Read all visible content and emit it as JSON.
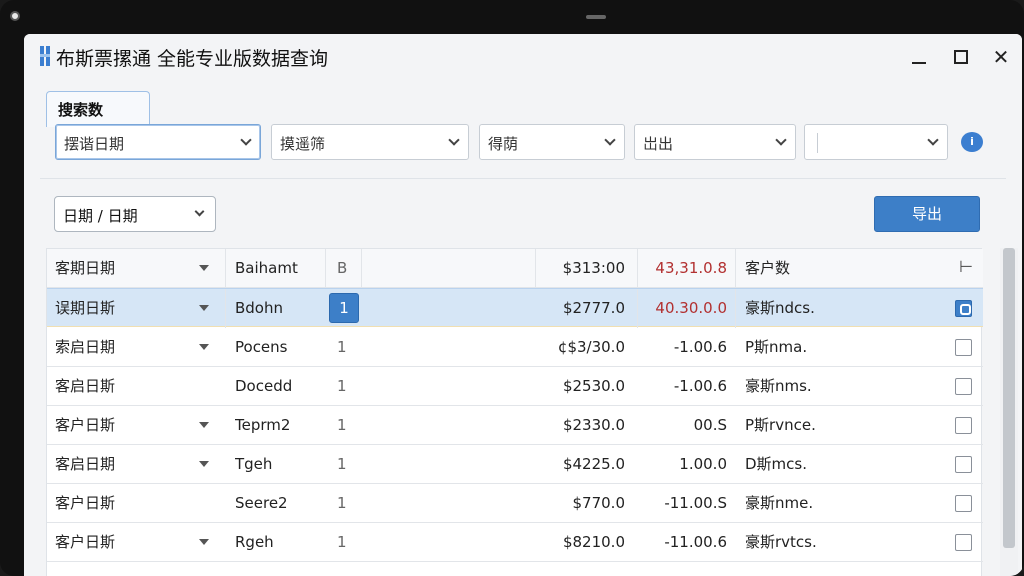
{
  "window": {
    "title": "布斯票摞通 全能专业版数据查询"
  },
  "search": {
    "tab_label": "搜索数",
    "filters": [
      {
        "label": "摆谐日期",
        "active": true
      },
      {
        "label": "摸遥筛",
        "active": false
      },
      {
        "label": "得荫",
        "active": false
      },
      {
        "label": "岀出",
        "active": false
      },
      {
        "label": "",
        "active": false
      }
    ],
    "info_badge": "i"
  },
  "toolbar": {
    "date_filter_label": "日期 / 日期",
    "export_label": "导出"
  },
  "table": {
    "header": {
      "name": "客期日期",
      "code": "Baihamt",
      "num": "B",
      "amount": "$313:00",
      "delta": "43,31.0.8",
      "customer": "客户数",
      "extra": "⊢"
    },
    "rows": [
      {
        "name": "误期日斯",
        "arrow": true,
        "code": "Bdohn",
        "num": "1",
        "amount": "$2777.0",
        "delta": "40.30.0.0",
        "customer": "豪斯ndcs.",
        "checked": true,
        "selected": true,
        "delta_red": true
      },
      {
        "name": "索启日期",
        "arrow": true,
        "code": "Pocens",
        "num": "1",
        "amount": "¢$3/30.0",
        "delta": "-1.00.6",
        "customer": "P斯nma.",
        "checked": false,
        "selected": false,
        "delta_red": false
      },
      {
        "name": "客启日斯",
        "arrow": false,
        "code": "Docedd",
        "num": "1",
        "amount": "$2530.0",
        "delta": "-1.00.6",
        "customer": "豪斯nms.",
        "checked": false,
        "selected": false,
        "delta_red": false
      },
      {
        "name": "客户日斯",
        "arrow": true,
        "code": "Teprm2",
        "num": "1",
        "amount": "$2330.0",
        "delta": "00.S",
        "customer": "P斯rvnce.",
        "checked": false,
        "selected": false,
        "delta_red": false
      },
      {
        "name": "客启日期",
        "arrow": true,
        "code": "Tgeh",
        "num": "1",
        "amount": "$4225.0",
        "delta": "1.00.0",
        "customer": "D斯mcs.",
        "checked": false,
        "selected": false,
        "delta_red": false
      },
      {
        "name": "客户日斯",
        "arrow": false,
        "code": "Seere2",
        "num": "1",
        "amount": "$770.0",
        "delta": "-11.00.S",
        "customer": "豪斯nme.",
        "checked": false,
        "selected": false,
        "delta_red": false
      },
      {
        "name": "客户日斯",
        "arrow": true,
        "code": "Rgeh",
        "num": "1",
        "amount": "$8210.0",
        "delta": "-11.00.6",
        "customer": "豪斯rvtcs.",
        "checked": false,
        "selected": false,
        "delta_red": false
      }
    ]
  },
  "colors": {
    "accent": "#3d7fc8",
    "selected_row": "#d6e6f6",
    "delta_red": "#b23030"
  }
}
